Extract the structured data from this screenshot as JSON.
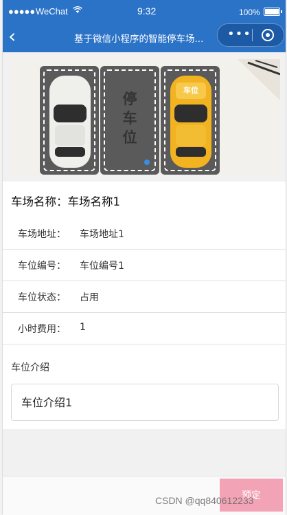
{
  "status_bar": {
    "signal": "●●●●●",
    "carrier": "WeChat",
    "time": "9:32",
    "battery": "100%"
  },
  "nav": {
    "title": "基于微信小程序的智能停车场...",
    "back_icon": "chevron-left-icon",
    "more_icon": "more-dots-icon",
    "close_icon": "target-circle-icon"
  },
  "banner": {
    "slot_text": [
      "停",
      "车",
      "位"
    ],
    "taxi_roof_text": "车位",
    "indicator_active": 0
  },
  "details": {
    "name_label": "车场名称：",
    "name_value": "车场名称1",
    "rows": [
      {
        "label": "车场地址：",
        "value": "车场地址1"
      },
      {
        "label": "车位编号：",
        "value": "车位编号1"
      },
      {
        "label": "车位状态：",
        "value": "占用"
      },
      {
        "label": "小时费用：",
        "value": "1"
      }
    ],
    "intro_label": "车位介绍",
    "intro_value": "车位介绍1"
  },
  "footer": {
    "reserve_label": "预定",
    "watermark": "CSDN @qq840612233"
  },
  "colors": {
    "nav_blue": "#2b73c7",
    "reserve_pink": "#f3a3b6",
    "indicator_blue": "#3a8de0"
  }
}
